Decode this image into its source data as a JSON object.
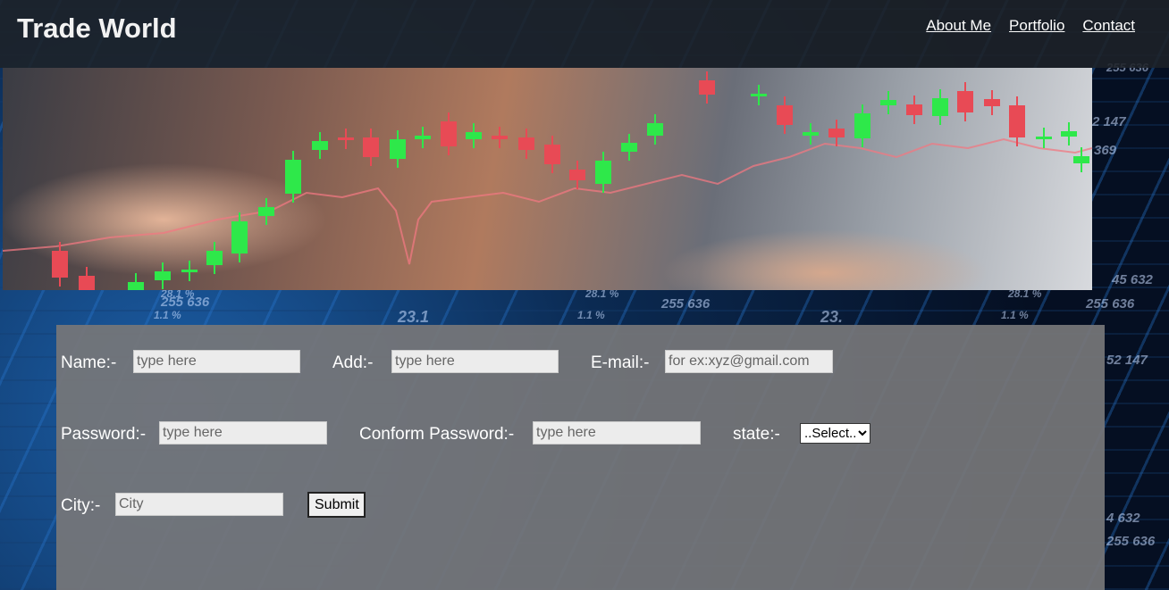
{
  "header": {
    "brand": "Trade World",
    "links": [
      "About Me",
      "Portfolio",
      "Contact"
    ]
  },
  "form": {
    "name_label": "Name:-",
    "name_placeholder": "type here",
    "add_label": "Add:-",
    "add_placeholder": "type here",
    "email_label": "E-mail:-",
    "email_placeholder": "for ex:xyz@gmail.com",
    "password_label": "Password:-",
    "password_placeholder": "type here",
    "confirm_label": "Conform Password:-",
    "confirm_placeholder": "type here",
    "state_label": "state:-",
    "state_selected": "..Select..",
    "city_label": "City:-",
    "city_placeholder": "City",
    "submit_label": "Submit"
  },
  "background_text": [
    "255 636",
    "28.1 %",
    "1.1 %",
    "23.1",
    "255 636",
    "28.1 %",
    "1.1 %",
    "23.",
    "255 636",
    "28.1 %",
    "1.1 %",
    "255 636",
    "45 632",
    "52 147",
    "2 147",
    "369",
    "255 636",
    "4 632"
  ],
  "colors": {
    "navbar": "#1e2228",
    "panel": "#767678",
    "candle_up": "#2ee84a",
    "candle_down": "#e84a55"
  }
}
